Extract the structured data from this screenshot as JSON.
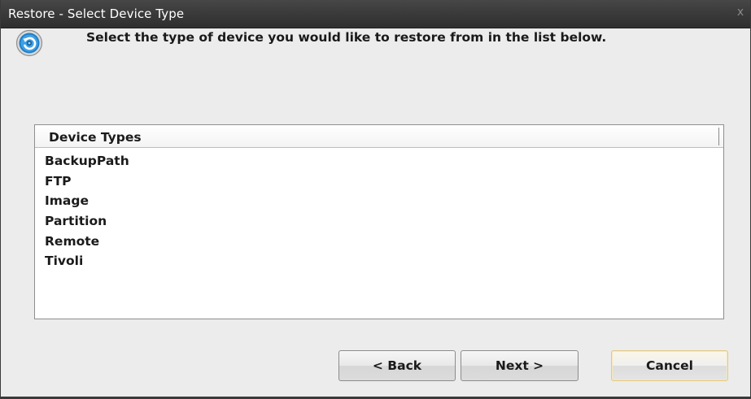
{
  "window": {
    "title": "Restore - Select Device Type",
    "close_glyph": "x"
  },
  "header": {
    "instruction": "Select the type of device you would like to restore from in the list below.",
    "icon": "restore-icon"
  },
  "device_list": {
    "column_header": "Device Types",
    "items": [
      {
        "label": "BackupPath"
      },
      {
        "label": "FTP"
      },
      {
        "label": "Image"
      },
      {
        "label": "Partition"
      },
      {
        "label": "Remote"
      },
      {
        "label": "Tivoli"
      }
    ]
  },
  "buttons": {
    "back_label": "< Back",
    "next_label": "Next >",
    "cancel_label": "Cancel"
  },
  "colors": {
    "titlebar": "#3b3b3b",
    "dialog_background": "#ececec",
    "icon_blue": "#2a8fd6",
    "default_button_border": "#e0c98a"
  }
}
